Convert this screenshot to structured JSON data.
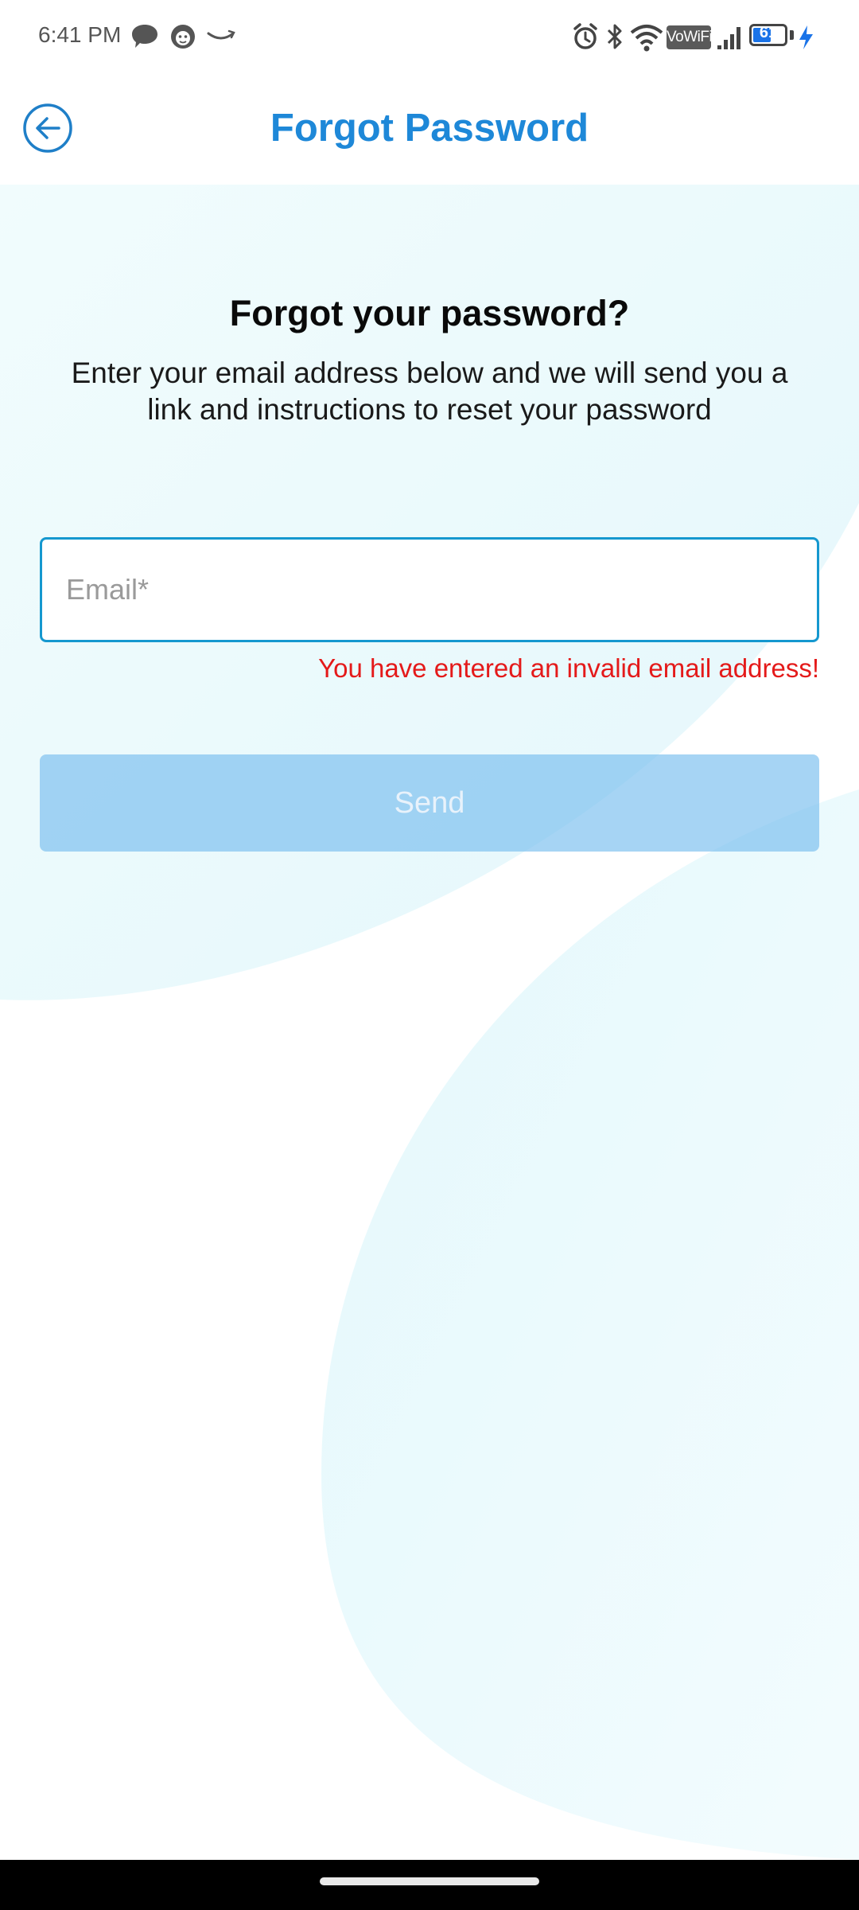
{
  "status_bar": {
    "time": "6:41 PM",
    "notification_icons": [
      "message-bubble-icon",
      "cat-face-icon",
      "amazon-smile-icon"
    ],
    "system_icons": [
      "alarm-icon",
      "bluetooth-icon",
      "wifi-icon",
      "vowifi-badge",
      "cell-signal-icon",
      "battery-icon",
      "charging-bolt-icon"
    ],
    "vowifi_label": "VoWiFi",
    "battery_level": "61",
    "battery_fraction": 0.61
  },
  "app_bar": {
    "title": "Forgot Password",
    "back_icon": "arrow-back-circle-icon"
  },
  "main": {
    "heading": "Forgot your password?",
    "description": "Enter your email address below and we will send you a link and instructions to reset your password",
    "email": {
      "value": "",
      "placeholder": "Email*"
    },
    "error_message": "You have entered an invalid email address!",
    "send_label": "Send"
  },
  "colors": {
    "accent": "#1e88d8",
    "field_border": "#1598cf",
    "error": "#e41a1a",
    "send_button": "#9ccff2",
    "background_tint": "#e6f8fc"
  }
}
